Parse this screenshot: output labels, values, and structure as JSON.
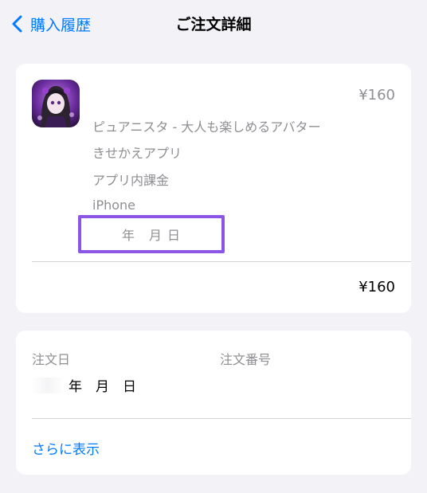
{
  "nav": {
    "back_label": "購入履歴",
    "title": "ご注文詳細"
  },
  "item": {
    "icon": "app-icon-avatar-character",
    "price": "¥160",
    "app_name": "ピュアニスタ - 大人も楽しめるアバター",
    "category": "きせかえアプリ",
    "type": "アプリ内課金",
    "device": "iPhone",
    "date": "年　月 日"
  },
  "total": {
    "price": "¥160"
  },
  "order": {
    "date_label": "注文日",
    "number_label": "注文番号",
    "date_value": "年　月　日",
    "more_label": "さらに表示"
  },
  "colors": {
    "accent": "#007aff",
    "highlight_border": "#8b55e6",
    "background": "#f2f2f7",
    "secondary_text": "#8e8e93"
  }
}
